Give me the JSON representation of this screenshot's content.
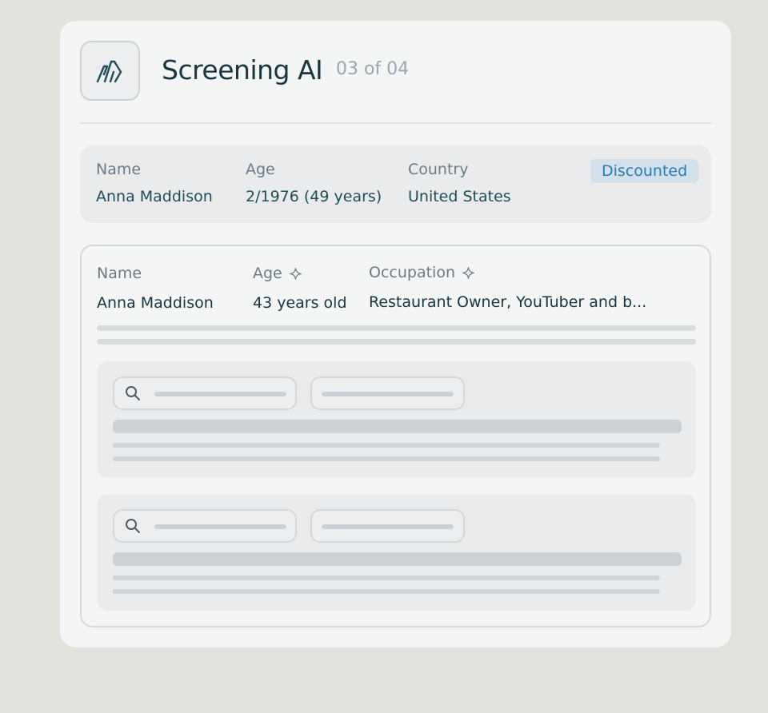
{
  "header": {
    "title": "Screening AI",
    "step": "03 of 04"
  },
  "summary": {
    "name_label": "Name",
    "name_value": "Anna Maddison",
    "age_label": "Age",
    "age_value": "2/1976 (49 years)",
    "country_label": "Country",
    "country_value": "United States",
    "status_badge": "Discounted"
  },
  "detail": {
    "name_label": "Name",
    "name_value": "Anna Maddison",
    "age_label": "Age",
    "age_value": "43 years old",
    "occupation_label": "Occupation",
    "occupation_value": "Restaurant Owner, YouTuber and b..."
  },
  "icons": {
    "logo": "brand-logo-icon",
    "ai": "sparkle-icon",
    "search": "search-icon"
  },
  "colors": {
    "title": "#17363f",
    "badge_bg": "#d2e1eb",
    "badge_text": "#2a7cb0",
    "value_text": "#1f4d58"
  }
}
